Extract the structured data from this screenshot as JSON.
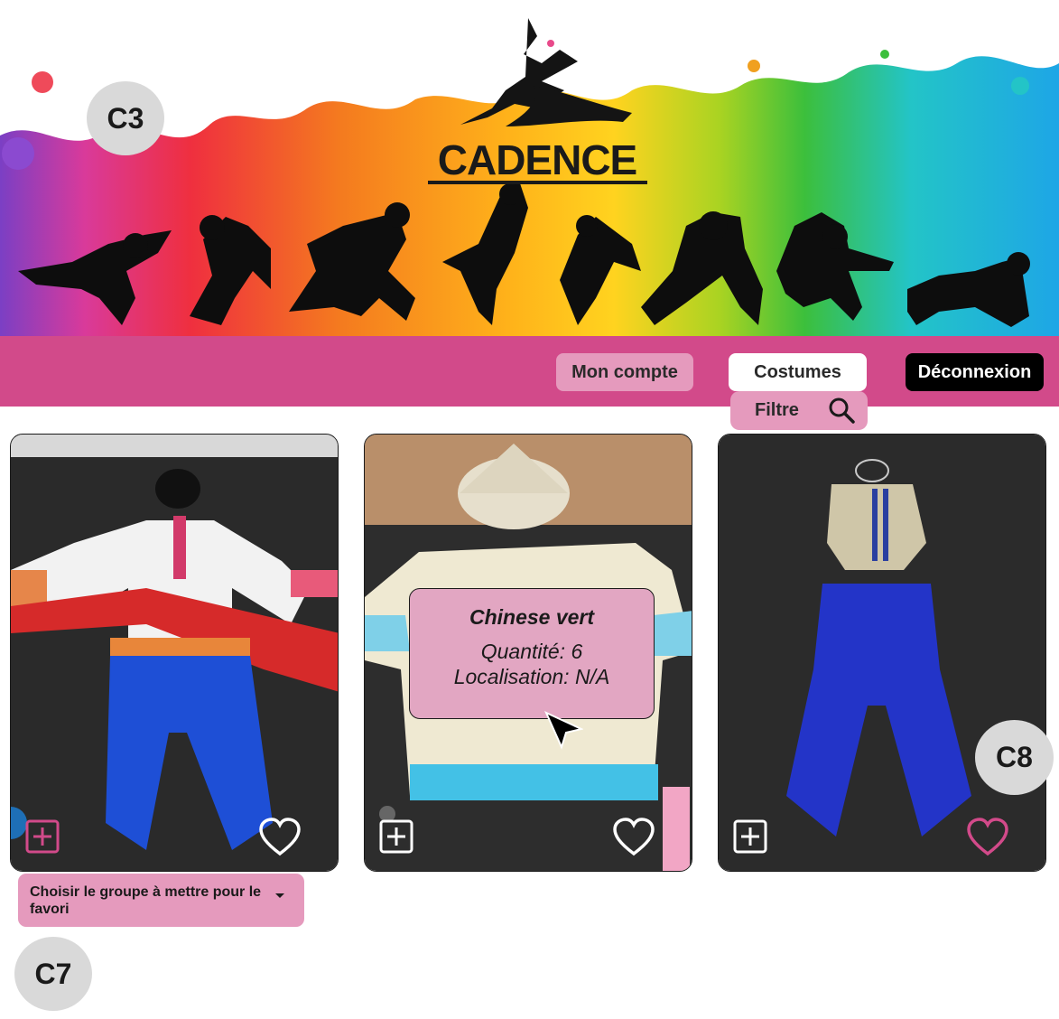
{
  "brand": {
    "name": "CADENCE"
  },
  "labels": {
    "c3": "C3",
    "c7": "C7",
    "c8": "C8"
  },
  "nav": {
    "account": "Mon compte",
    "costumes": "Costumes",
    "logout": "Déconnexion",
    "filter": "Filtre"
  },
  "tooltip": {
    "name": "Chinese vert",
    "quantity": "Quantité: 6",
    "location": "Localisation: N/A"
  },
  "dropdown": {
    "label": "Choisir le groupe à mettre pour le favori"
  },
  "cards": [
    {
      "icon_add": "plus-square-icon",
      "icon_fav": "heart-outline-icon",
      "favorited": false
    },
    {
      "icon_add": "plus-square-icon",
      "icon_fav": "heart-outline-icon",
      "favorited": false
    },
    {
      "icon_add": "plus-square-icon",
      "icon_fav": "heart-outline-icon",
      "favorited": true
    }
  ],
  "colors": {
    "brand_pink": "#d24a8a",
    "light_pink": "#e59abd",
    "black": "#000000"
  }
}
